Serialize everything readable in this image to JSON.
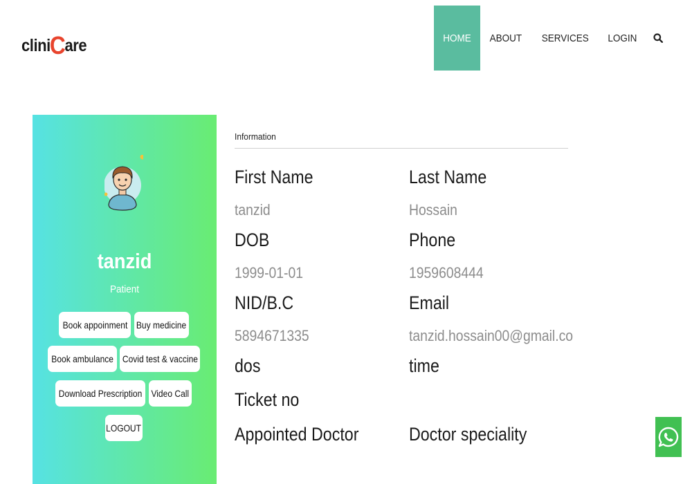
{
  "brand": {
    "prefix": "clini",
    "accent_letter": "C",
    "suffix": "are",
    "accent_color": "#e8442d"
  },
  "nav": {
    "items": [
      {
        "label": "HOME",
        "active": true
      },
      {
        "label": "ABOUT",
        "active": false
      },
      {
        "label": "SERVICES",
        "active": false
      },
      {
        "label": "LOGIN",
        "active": false
      }
    ],
    "search_icon": "search-icon",
    "active_color": "#5abc9f"
  },
  "profile": {
    "avatar_icon": "user-avatar-icon",
    "name": "tanzid",
    "role": "Patient",
    "actions": {
      "book_appointment": "Book appoinment",
      "buy_medicine": "Buy medicine",
      "book_ambulance": "Book ambulance",
      "covid_test": "Covid test & vaccine",
      "download_prescription": "Download Prescription",
      "video_call": "Video Call",
      "logout": "LOGOUT"
    },
    "gradient": [
      "#56e2e3",
      "#69ec72"
    ]
  },
  "info": {
    "heading": "Information",
    "first_name": {
      "label": "First Name",
      "value": "tanzid"
    },
    "last_name": {
      "label": "Last Name",
      "value": "Hossain"
    },
    "dob": {
      "label": "DOB",
      "value": "1999-01-01"
    },
    "phone": {
      "label": "Phone",
      "value": "1959608444"
    },
    "nid": {
      "label": "NID/B.C",
      "value": "5894671335"
    },
    "email": {
      "label": "Email",
      "value": "tanzid.hossain00@gmail.co"
    },
    "dos": {
      "label": "dos"
    },
    "time": {
      "label": "time"
    },
    "ticket": {
      "label": "Ticket no"
    },
    "doctor": {
      "label": "Appointed Doctor"
    },
    "speciality": {
      "label": "Doctor speciality"
    }
  },
  "whatsapp": {
    "icon": "whatsapp-icon",
    "color": "#41c052"
  }
}
